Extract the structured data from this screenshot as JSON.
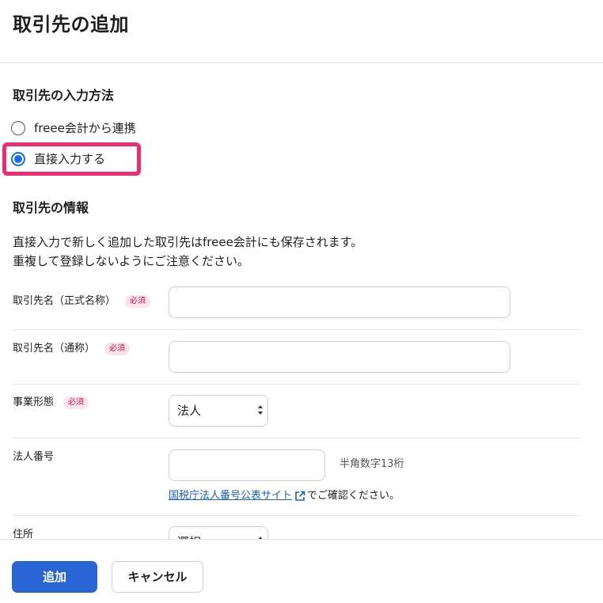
{
  "page": {
    "title": "取引先の追加"
  },
  "input_method": {
    "heading": "取引先の入力方法",
    "options": [
      {
        "label": "freee会計から連携",
        "selected": false
      },
      {
        "label": "直接入力する",
        "selected": true
      }
    ],
    "highlight_color": "#ee2d6f"
  },
  "info": {
    "heading": "取引先の情報",
    "description_line1": "直接入力で新しく追加した取引先はfreee会計にも保存されます。",
    "description_line2": "重複して登録しないようにご注意ください。"
  },
  "form": {
    "required_label": "必須",
    "official_name": {
      "label": "取引先名（正式名称）",
      "value": ""
    },
    "common_name": {
      "label": "取引先名（通称）",
      "value": ""
    },
    "business_type": {
      "label": "事業形態",
      "selected": "法人"
    },
    "corporate_number": {
      "label": "法人番号",
      "value": "",
      "hint": "半角数字13桁",
      "link_text": "国税庁法人番号公表サイト",
      "link_suffix": "でご確認ください。"
    },
    "address": {
      "label": "住所",
      "selected": "選択"
    }
  },
  "footer": {
    "add_label": "追加",
    "cancel_label": "キャンセル",
    "primary_color": "#2864d4"
  }
}
